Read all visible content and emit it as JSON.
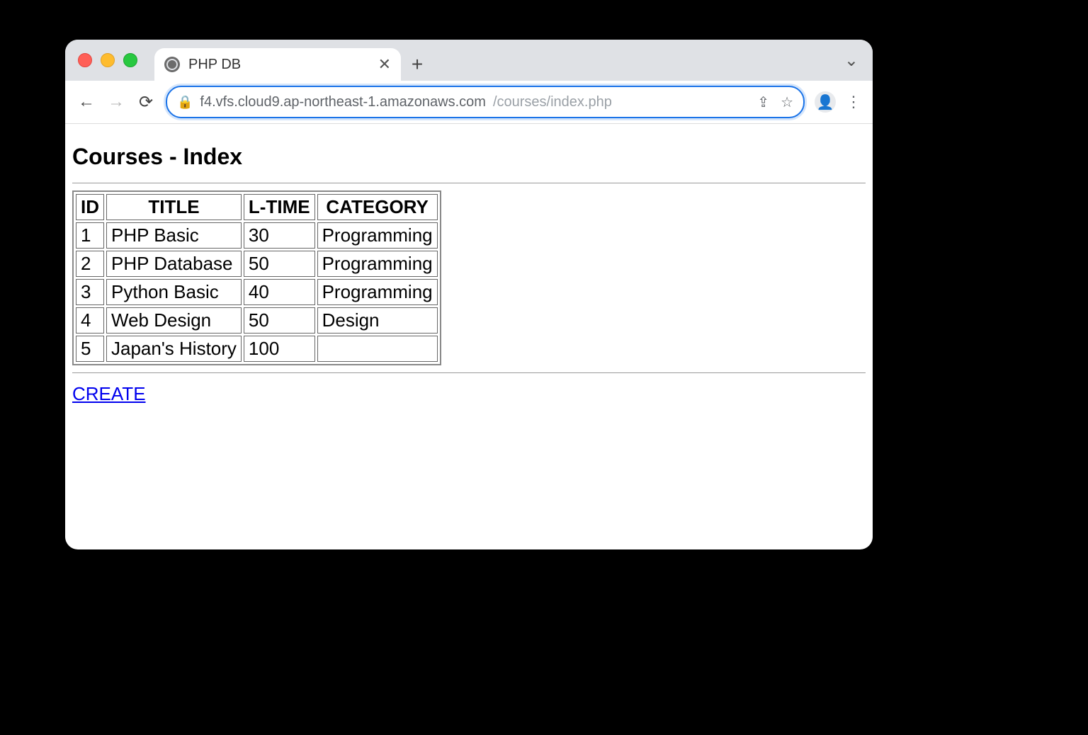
{
  "browser": {
    "tab_title": "PHP DB",
    "url_host": "f4.vfs.cloud9.ap-northeast-1.amazonaws.com",
    "url_path": "/courses/index.php"
  },
  "page": {
    "heading": "Courses - Index",
    "create_link": "CREATE",
    "table": {
      "headers": [
        "ID",
        "TITLE",
        "L-TIME",
        "CATEGORY"
      ],
      "rows": [
        {
          "id": "1",
          "title": "PHP Basic",
          "ltime": "30",
          "category": "Programming"
        },
        {
          "id": "2",
          "title": "PHP Database",
          "ltime": "50",
          "category": "Programming"
        },
        {
          "id": "3",
          "title": "Python Basic",
          "ltime": "40",
          "category": "Programming"
        },
        {
          "id": "4",
          "title": "Web Design",
          "ltime": "50",
          "category": "Design"
        },
        {
          "id": "5",
          "title": "Japan's History",
          "ltime": "100",
          "category": ""
        }
      ]
    }
  }
}
